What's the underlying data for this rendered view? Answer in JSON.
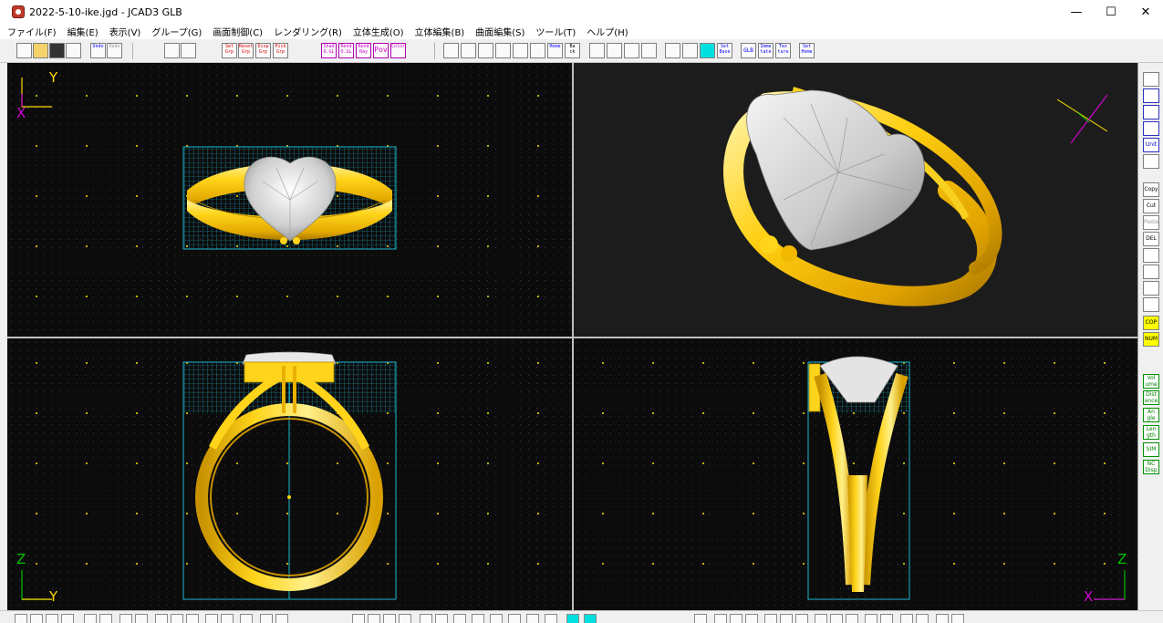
{
  "window": {
    "title": "2022-5-10-ike.jgd - JCAD3 GLB",
    "controls": {
      "minimize": "—",
      "maximize": "☐",
      "close": "✕"
    }
  },
  "menu": [
    "ファイル(F)",
    "編集(E)",
    "表示(V)",
    "グループ(G)",
    "画面制御(C)",
    "レンダリング(R)",
    "立体生成(O)",
    "立体編集(B)",
    "曲面編集(S)",
    "ツール(T)",
    "ヘルプ(H)"
  ],
  "toolbar": {
    "undo": "Undo",
    "redo": "Redo",
    "set_grp": "Set Grp",
    "reset_grp": "Reset Grp",
    "disp_grp": "Disp Grp",
    "pick_grp": "Pick Grp",
    "shad_ogl": "Shad O.GL",
    "rend_ogl": "Rend O.GL",
    "rend_ray": "Rend Ray",
    "pov": "Pov",
    "color": "Color",
    "home": "Home",
    "back": "Ba ck",
    "set_base": "Set Base",
    "glb": "GLB",
    "imme_tate": "Imme tate",
    "tex_ture": "Tex ture",
    "set_home": "Set Home"
  },
  "viewports": {
    "top": {
      "axis_v": "Y",
      "axis_h": "X"
    },
    "front": {
      "axis_v": "Z",
      "axis_h": "Y"
    },
    "side": {
      "axis_v": "Z",
      "axis_h": "X"
    }
  },
  "side_panel": {
    "unit": "Unit",
    "copy": "Copy",
    "cut": "Cut",
    "paste": "Paste",
    "del": "DEL",
    "cop": "COP",
    "num": "NUM",
    "volume": "Vol ume",
    "distance": "Dist ance",
    "angle": "An gle",
    "length": "Len gth",
    "sim": "SIM",
    "nc_disp": "NC Disp"
  },
  "colors": {
    "viewport_bg": "#0c0c0c",
    "grid_dot": "#8a8a2a",
    "gold": "#f5c400",
    "gold_light": "#ffe45a",
    "gold_dark": "#b88a00",
    "gem": "#d8d8d8",
    "bbox": "#00c8e0",
    "axis_yellow": "#ffd800",
    "axis_magenta": "#d000d0",
    "axis_green": "#00c000"
  }
}
